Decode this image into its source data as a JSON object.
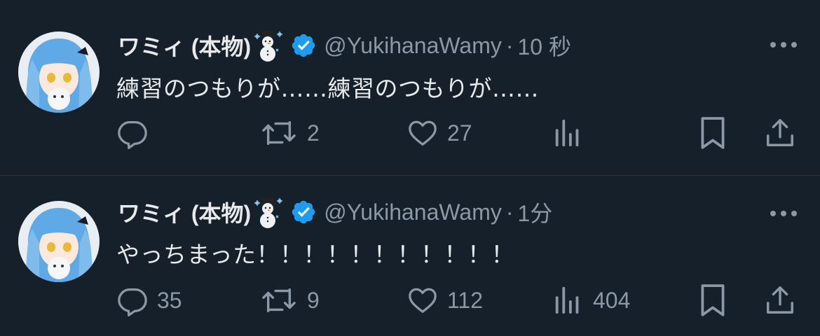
{
  "tweets": [
    {
      "display_name": "ワミィ (本物)",
      "handle": "@YukihanaWamy",
      "separator": "·",
      "time": "10 秒",
      "text": "練習のつもりが……練習のつもりが……",
      "replies": "",
      "retweets": "2",
      "likes": "27",
      "views": ""
    },
    {
      "display_name": "ワミィ (本物)",
      "handle": "@YukihanaWamy",
      "separator": "·",
      "time": "1分",
      "text": "やっちまった！！！！！！！！！！！",
      "replies": "35",
      "retweets": "9",
      "likes": "112",
      "views": "404"
    }
  ],
  "icons": {
    "name_emoji": "snowman-icon",
    "badge": "verified-badge-icon",
    "more": "more-icon",
    "reply": "reply-icon",
    "retweet": "retweet-icon",
    "like": "heart-icon",
    "views": "views-icon",
    "bookmark": "bookmark-icon",
    "share": "share-icon"
  },
  "colors": {
    "background": "#15202b",
    "text": "#e7e9ea",
    "secondary": "#8b98a5",
    "verified": "#1d9bf0",
    "divider": "#2f3336"
  }
}
